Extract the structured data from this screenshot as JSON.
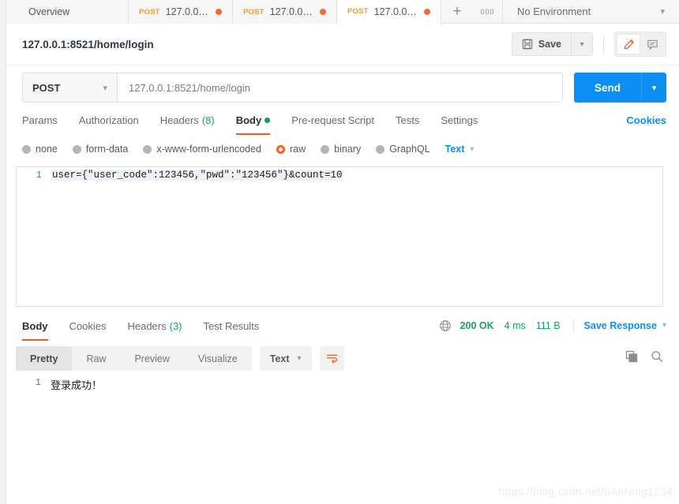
{
  "tabstrip": {
    "overview_label": "Overview",
    "tabs": [
      {
        "method": "POST",
        "label": "127.0.0.1:...",
        "unsaved": true,
        "active": false
      },
      {
        "method": "POST",
        "label": "127.0.0.1:...",
        "unsaved": true,
        "active": false
      },
      {
        "method": "POST",
        "label": "127.0.0.1:...",
        "unsaved": true,
        "active": true
      }
    ],
    "new_tab_glyph": "+",
    "more_glyph": "000",
    "environment": "No Environment"
  },
  "request_header": {
    "title": "127.0.0.1:8521/home/login",
    "save_label": "Save"
  },
  "url_row": {
    "method": "POST",
    "url": "127.0.0.1:8521/home/login",
    "send_label": "Send"
  },
  "request_tabs": {
    "items": [
      {
        "label": "Params",
        "count": "",
        "active": false
      },
      {
        "label": "Authorization",
        "count": "",
        "active": false
      },
      {
        "label": "Headers",
        "count": "(8)",
        "active": false
      },
      {
        "label": "Body",
        "count": "",
        "active": true
      },
      {
        "label": "Pre-request Script",
        "count": "",
        "active": false
      },
      {
        "label": "Tests",
        "count": "",
        "active": false
      },
      {
        "label": "Settings",
        "count": "",
        "active": false
      }
    ],
    "cookies_link": "Cookies"
  },
  "body_types": {
    "options": [
      {
        "label": "none",
        "selected": false
      },
      {
        "label": "form-data",
        "selected": false
      },
      {
        "label": "x-www-form-urlencoded",
        "selected": false
      },
      {
        "label": "raw",
        "selected": true
      },
      {
        "label": "binary",
        "selected": false
      },
      {
        "label": "GraphQL",
        "selected": false
      }
    ],
    "format": "Text"
  },
  "body_editor": {
    "line_number": "1",
    "content": "user={\"user_code\":123456,\"pwd\":\"123456\"}&count=10"
  },
  "response_tabs": {
    "items": [
      {
        "label": "Body",
        "count": "",
        "active": true
      },
      {
        "label": "Cookies",
        "count": "",
        "active": false
      },
      {
        "label": "Headers",
        "count": "(3)",
        "active": false
      },
      {
        "label": "Test Results",
        "count": "",
        "active": false
      }
    ],
    "status": "200 OK",
    "time": "4 ms",
    "size": "111 B",
    "save_response": "Save Response"
  },
  "response_toolbar": {
    "views": [
      {
        "label": "Pretty",
        "active": true
      },
      {
        "label": "Raw",
        "active": false
      },
      {
        "label": "Preview",
        "active": false
      },
      {
        "label": "Visualize",
        "active": false
      }
    ],
    "format": "Text"
  },
  "response_body": {
    "line_number": "1",
    "content": "登录成功！"
  },
  "watermark": "https://blog.csdn.net/oAnNing1234",
  "colors": {
    "accent_orange": "#ef5b25",
    "method_orange": "#ff9a1f",
    "send_blue": "#0d8ef5",
    "link_blue": "#0d8ef5",
    "status_green": "#1aa260"
  }
}
